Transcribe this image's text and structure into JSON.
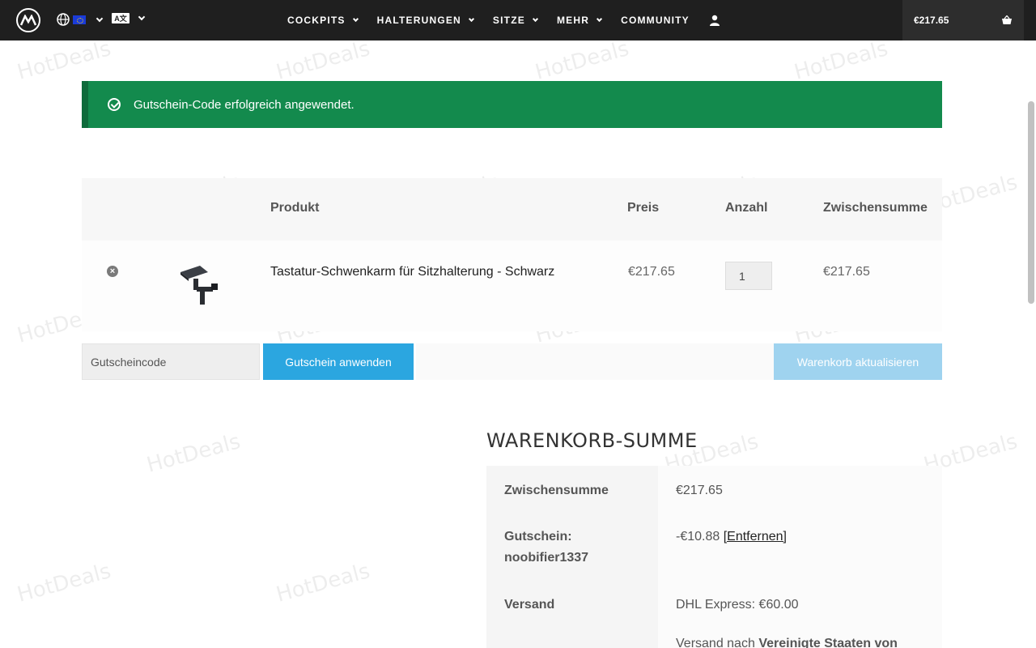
{
  "header": {
    "logo": "brand-logo",
    "nav": [
      {
        "label": "COCKPITS",
        "has_menu": true
      },
      {
        "label": "HALTERUNGEN",
        "has_menu": true
      },
      {
        "label": "SITZE",
        "has_menu": true
      },
      {
        "label": "MEHR",
        "has_menu": true
      },
      {
        "label": "COMMUNITY",
        "has_menu": false
      }
    ],
    "translate_label": "A文",
    "cart_total": "€217.65"
  },
  "notice": {
    "message": "Gutschein-Code erfolgreich angewendet."
  },
  "cart_table": {
    "headers": {
      "product": "Produkt",
      "price": "Preis",
      "quantity": "Anzahl",
      "subtotal": "Zwischensumme"
    },
    "items": [
      {
        "name": "Tastatur-Schwenkarm für Sitzhalterung - Schwarz",
        "price": "€217.65",
        "quantity": "1",
        "subtotal": "€217.65"
      }
    ],
    "remove_symbol": "×"
  },
  "actions": {
    "coupon_placeholder": "Gutscheincode",
    "apply_label": "Gutschein anwenden",
    "update_label": "Warenkorb aktualisieren"
  },
  "totals": {
    "title": "WARENKORB-SUMME",
    "subtotal_label": "Zwischensumme",
    "subtotal_value": "€217.65",
    "coupon_label_line1": "Gutschein:",
    "coupon_label_line2": "noobifier1337",
    "coupon_value": "-€10.88",
    "coupon_remove": "[Entfernen]",
    "shipping_label": "Versand",
    "shipping_value": "DHL Express: €60.00",
    "shipping_to_prefix": "Versand nach",
    "shipping_to_country": "Vereinigte Staaten von"
  },
  "watermark": "HotDeals",
  "colors": {
    "header_bg": "#1f1f1f",
    "success": "#138a4d",
    "button": "#2ba6e0",
    "button_disabled": "#9fd3ef"
  }
}
